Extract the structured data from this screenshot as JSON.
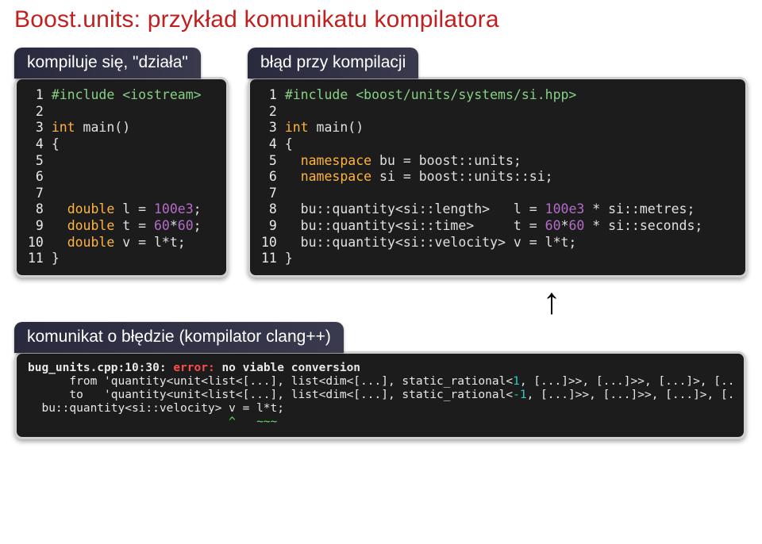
{
  "title": "Boost.units: przykład komunikatu kompilatora",
  "left": {
    "header": "kompiluje się, \"działa\"",
    "lines": [
      {
        "n": "1",
        "seg": [
          {
            "c": "inc",
            "t": "#include <iostream>"
          }
        ]
      },
      {
        "n": "2",
        "seg": []
      },
      {
        "n": "3",
        "seg": [
          {
            "c": "kw",
            "t": "int"
          },
          {
            "c": "id",
            "t": " main()"
          }
        ]
      },
      {
        "n": "4",
        "seg": [
          {
            "c": "glyph",
            "t": "{"
          }
        ]
      },
      {
        "n": "5",
        "seg": []
      },
      {
        "n": "6",
        "seg": []
      },
      {
        "n": "7",
        "seg": []
      },
      {
        "n": "8",
        "seg": [
          {
            "c": "id",
            "t": "  "
          },
          {
            "c": "kw",
            "t": "double"
          },
          {
            "c": "id",
            "t": " l = "
          },
          {
            "c": "num",
            "t": "100e3"
          },
          {
            "c": "glyph",
            "t": ";"
          }
        ]
      },
      {
        "n": "9",
        "seg": [
          {
            "c": "id",
            "t": "  "
          },
          {
            "c": "kw",
            "t": "double"
          },
          {
            "c": "id",
            "t": " t = "
          },
          {
            "c": "num",
            "t": "60"
          },
          {
            "c": "glyph",
            "t": "*"
          },
          {
            "c": "num",
            "t": "60"
          },
          {
            "c": "glyph",
            "t": ";"
          }
        ]
      },
      {
        "n": "10",
        "seg": [
          {
            "c": "id",
            "t": "  "
          },
          {
            "c": "kw",
            "t": "double"
          },
          {
            "c": "id",
            "t": " v = l*t;"
          }
        ]
      },
      {
        "n": "11",
        "seg": [
          {
            "c": "glyph",
            "t": "}"
          }
        ]
      }
    ]
  },
  "right": {
    "header": "błąd przy kompilacji",
    "lines": [
      {
        "n": "1",
        "seg": [
          {
            "c": "inc",
            "t": "#include <boost/units/systems/si.hpp>"
          }
        ]
      },
      {
        "n": "2",
        "seg": []
      },
      {
        "n": "3",
        "seg": [
          {
            "c": "kw",
            "t": "int"
          },
          {
            "c": "id",
            "t": " main()"
          }
        ]
      },
      {
        "n": "4",
        "seg": [
          {
            "c": "glyph",
            "t": "{"
          }
        ]
      },
      {
        "n": "5",
        "seg": [
          {
            "c": "id",
            "t": "  "
          },
          {
            "c": "kw",
            "t": "namespace"
          },
          {
            "c": "id",
            "t": " bu = boost::units;"
          }
        ]
      },
      {
        "n": "6",
        "seg": [
          {
            "c": "id",
            "t": "  "
          },
          {
            "c": "kw",
            "t": "namespace"
          },
          {
            "c": "id",
            "t": " si = boost::units::si;"
          }
        ]
      },
      {
        "n": "7",
        "seg": []
      },
      {
        "n": "8",
        "seg": [
          {
            "c": "id",
            "t": "  bu::quantity<si::length>   l = "
          },
          {
            "c": "num",
            "t": "100e3"
          },
          {
            "c": "id",
            "t": " * si::metres;"
          }
        ]
      },
      {
        "n": "9",
        "seg": [
          {
            "c": "id",
            "t": "  bu::quantity<si::time>     t = "
          },
          {
            "c": "num",
            "t": "60"
          },
          {
            "c": "glyph",
            "t": "*"
          },
          {
            "c": "num",
            "t": "60"
          },
          {
            "c": "id",
            "t": " * si::seconds;"
          }
        ]
      },
      {
        "n": "10",
        "seg": [
          {
            "c": "id",
            "t": "  bu::quantity<si::velocity> v = l*t;"
          }
        ]
      },
      {
        "n": "11",
        "seg": [
          {
            "c": "glyph",
            "t": "}"
          }
        ]
      }
    ]
  },
  "arrow": "↑",
  "error": {
    "header": "komunikat o błędzie (kompilator clang++)",
    "segments": [
      {
        "c": "err-white",
        "t": "bug_units.cpp:10:30: "
      },
      {
        "c": "err-red",
        "t": "error: "
      },
      {
        "c": "err-white",
        "t": "no viable conversion"
      },
      {
        "c": "br",
        "t": ""
      },
      {
        "c": "err-txt",
        "t": "      from 'quantity<unit<list<[...], list<dim<[...], static_rational<"
      },
      {
        "c": "err-cyan",
        "t": "1"
      },
      {
        "c": "err-txt",
        "t": ", [...]>>, [...]>>, [...]>, [...]>'"
      },
      {
        "c": "br",
        "t": ""
      },
      {
        "c": "err-txt",
        "t": "      to   'quantity<unit<list<[...], list<dim<[...], static_rational<"
      },
      {
        "c": "err-cyan",
        "t": "-1"
      },
      {
        "c": "err-txt",
        "t": ", [...]>>, [...]>>, [...]>, [...]>'"
      },
      {
        "c": "br",
        "t": ""
      },
      {
        "c": "err-txt",
        "t": "  bu::quantity<si::velocity> v = l*t;"
      },
      {
        "c": "br",
        "t": ""
      },
      {
        "c": "err-green",
        "t": "                             ^   ~~~"
      }
    ]
  }
}
